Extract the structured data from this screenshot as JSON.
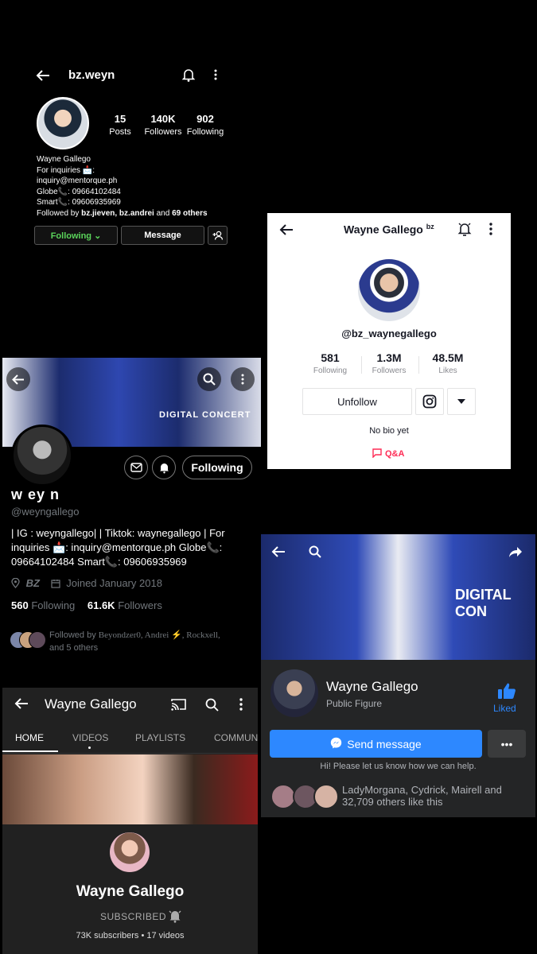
{
  "instagram": {
    "username": "bz.weyn",
    "stats": [
      {
        "value": "15",
        "label": "Posts"
      },
      {
        "value": "140K",
        "label": "Followers"
      },
      {
        "value": "902",
        "label": "Following"
      }
    ],
    "bio": {
      "name": "Wayne Gallego",
      "line1": "For inquiries 📩:",
      "line2": "inquiry@mentorque.ph",
      "line3": "Globe📞: 09664102484",
      "line4": "Smart📞: 09606935969",
      "followed_prefix": "Followed by ",
      "followed_names": "bz.jieven, bz.andrei",
      "followed_and": " and ",
      "followed_others": "69 others"
    },
    "following_btn": "Following ⌄",
    "message_btn": "Message"
  },
  "tiktok": {
    "name": "Wayne Gallego",
    "name_suffix": "bz",
    "handle": "@bz_waynegallego",
    "stats": [
      {
        "value": "581",
        "label": "Following"
      },
      {
        "value": "1.3M",
        "label": "Followers"
      },
      {
        "value": "48.5M",
        "label": "Likes"
      }
    ],
    "unfollow_btn": "Unfollow",
    "no_bio": "No bio yet",
    "qa": "Q&A"
  },
  "twitter": {
    "banner_text": "DIGITAL CONCERT",
    "following_btn": "Following",
    "name": "w ey n",
    "handle": "@weyngallego",
    "bio": "| IG : weyngallego| | Tiktok: waynegallego | For inquiries 📩: inquiry@mentorque.ph Globe📞: 09664102484 Smart📞: 09606935969",
    "location": "BZ",
    "joined": "Joined January 2018",
    "following_count": "560",
    "following_label": "Following",
    "followers_count": "61.6K",
    "followers_label": "Followers",
    "followed_prefix": "Followed by ",
    "followed_names": "Beyondzer0, Andrei ⚡, Rockxell,",
    "followed_rest": "and 5 others"
  },
  "facebook": {
    "cover_text": "DIGITAL CON",
    "name": "Wayne Gallego",
    "category": "Public Figure",
    "liked": "Liked",
    "send_message": "Send message",
    "more": "•••",
    "hint": "Hi! Please let us know how we can help.",
    "likes_text": "LadyMorgana, Cydrick, Mairell and 32,709 others like this"
  },
  "youtube": {
    "title": "Wayne Gallego",
    "tabs": [
      "HOME",
      "VIDEOS",
      "PLAYLISTS",
      "COMMUN"
    ],
    "channel_name": "Wayne Gallego",
    "subscribed": "SUBSCRIBED",
    "stats": "73K subscribers • 17 videos"
  },
  "colors": {
    "ig_following_green": "#5bd45b",
    "tiktok_red": "#fe2c55",
    "fb_blue": "#2d88ff"
  }
}
